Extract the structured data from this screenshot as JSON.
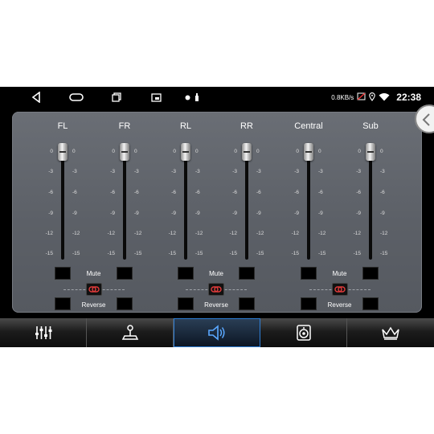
{
  "status_bar": {
    "speed": "0.8KB/s",
    "time": "22:38",
    "icons": [
      "back-icon",
      "home-icon",
      "recents-icon",
      "screen-mirror-icon",
      "notification-dot-icon",
      "usb-icon",
      "no-sim-icon",
      "location-icon",
      "wifi-icon"
    ]
  },
  "channels": [
    {
      "label": "FL",
      "level_db": 0
    },
    {
      "label": "FR",
      "level_db": 0
    },
    {
      "label": "RL",
      "level_db": 0
    },
    {
      "label": "RR",
      "level_db": 0
    },
    {
      "label": "Central",
      "level_db": 0
    },
    {
      "label": "Sub",
      "level_db": 0
    }
  ],
  "scale": [
    "0",
    "-3",
    "-6",
    "-9",
    "-12",
    "-15"
  ],
  "groups": [
    {
      "mute_label": "Mute",
      "reverse_label": "Reverse"
    },
    {
      "mute_label": "Mute",
      "reverse_label": "Reverse"
    },
    {
      "mute_label": "Mute",
      "reverse_label": "Reverse"
    }
  ],
  "tabs": [
    {
      "icon": "equalizer-sliders-icon",
      "active": false
    },
    {
      "icon": "joystick-balance-icon",
      "active": false
    },
    {
      "icon": "speaker-volume-icon",
      "active": true
    },
    {
      "icon": "subwoofer-icon",
      "active": false
    },
    {
      "icon": "crown-icon",
      "active": false
    }
  ],
  "colors": {
    "accent": "#2f7fd6",
    "panel": "#5f636a",
    "background": "#000000"
  }
}
